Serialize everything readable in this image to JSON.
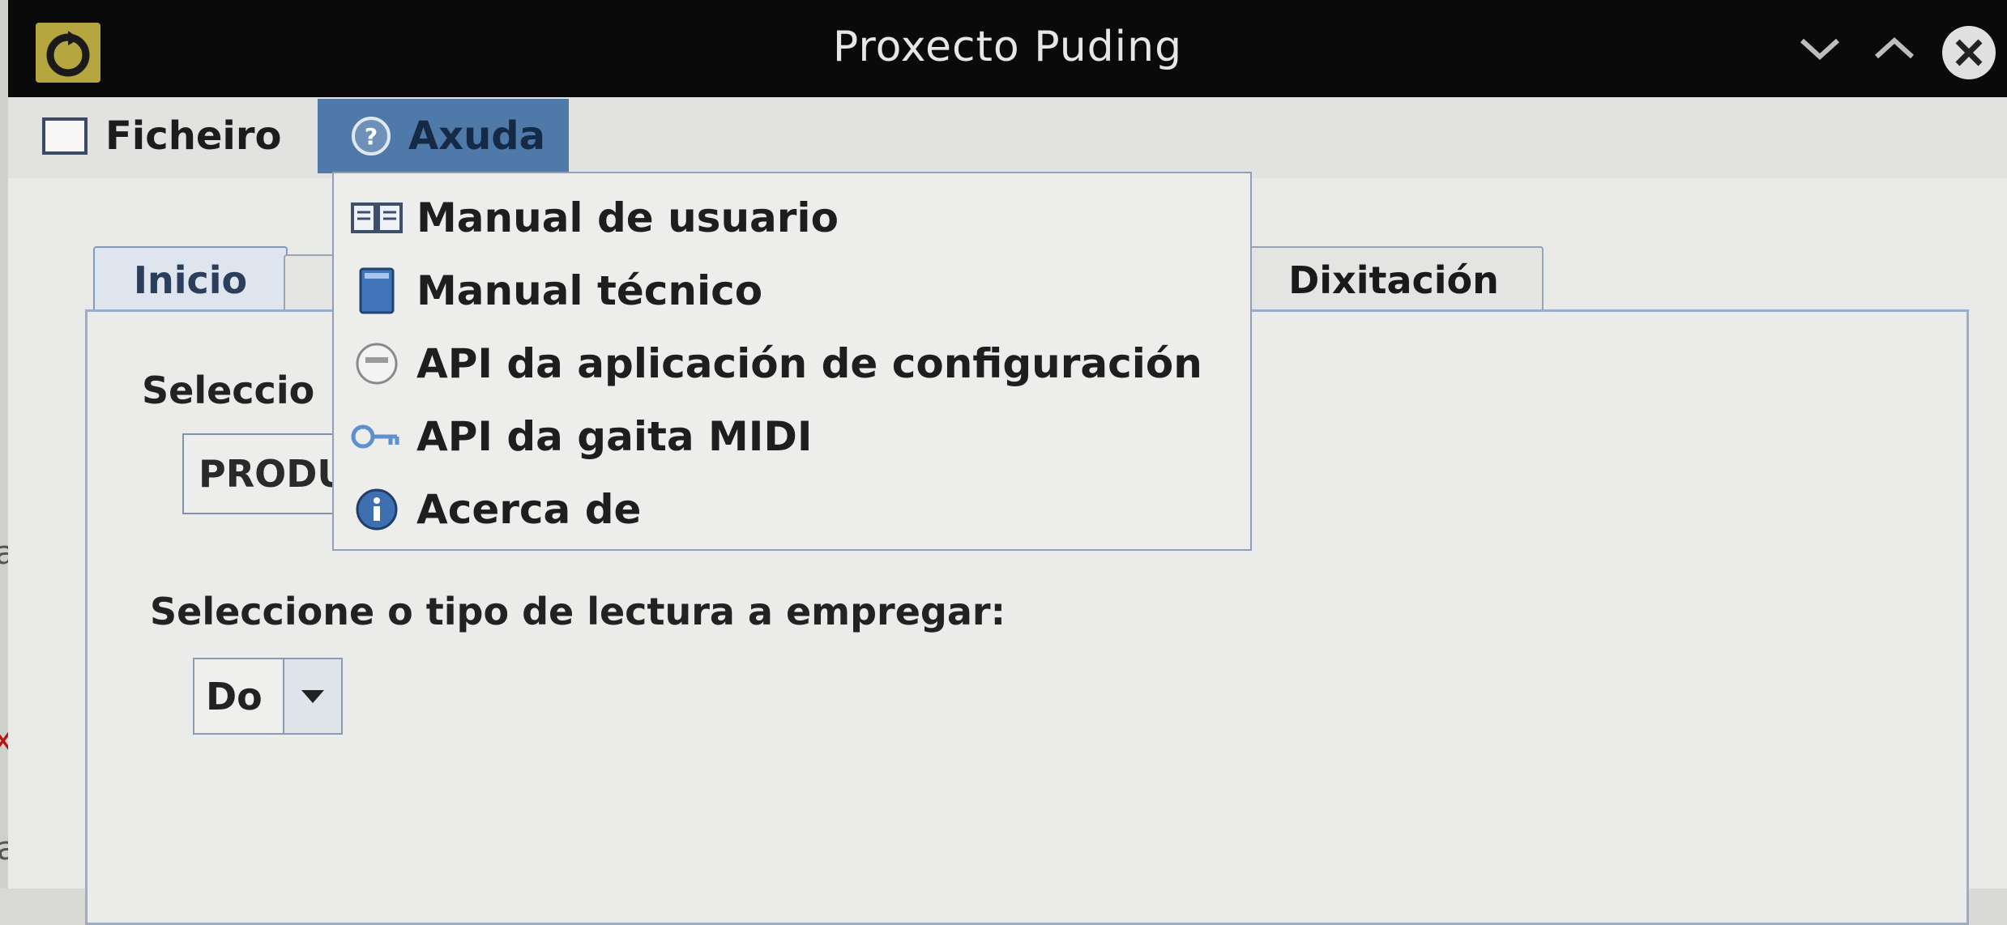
{
  "window": {
    "title": "Proxecto Puding"
  },
  "titlebar_buttons": [
    {
      "name": "minimize",
      "icon": "chevron-down-icon"
    },
    {
      "name": "maximize",
      "icon": "chevron-up-icon"
    },
    {
      "name": "close",
      "icon": "close-icon"
    }
  ],
  "menubar": {
    "items": [
      {
        "label": "Ficheiro",
        "icon": "file-icon",
        "open": false
      },
      {
        "label": "Axuda",
        "icon": "help-icon",
        "open": true
      }
    ]
  },
  "help_menu": {
    "items": [
      {
        "label": "Manual de usuario",
        "icon": "open-book-icon"
      },
      {
        "label": "Manual técnico",
        "icon": "book-icon"
      },
      {
        "label": "API da aplicación de configuración",
        "icon": "document-icon"
      },
      {
        "label": "API da gaita MIDI",
        "icon": "key-icon"
      },
      {
        "label": "Acerca de",
        "icon": "info-icon"
      }
    ]
  },
  "tabs": [
    {
      "label": "Inicio",
      "selected": true
    },
    {
      "label": "",
      "selected": false
    },
    {
      "label": "Dixitación",
      "selected": false
    }
  ],
  "main": {
    "select_label_partial": "Seleccio",
    "product_combo_value_partial": "PRODU",
    "reading_label": "Seleccione o tipo de lectura a empregar:",
    "reading_combo_value": "Do"
  },
  "background": {
    "left_glyphs": [
      "a",
      "x",
      "ac"
    ]
  },
  "colors": {
    "titlebar": "#0a0a0a",
    "menu_highlight": "#4f79a8",
    "panel_border": "#98aecb",
    "background": "#e9e9e7"
  }
}
